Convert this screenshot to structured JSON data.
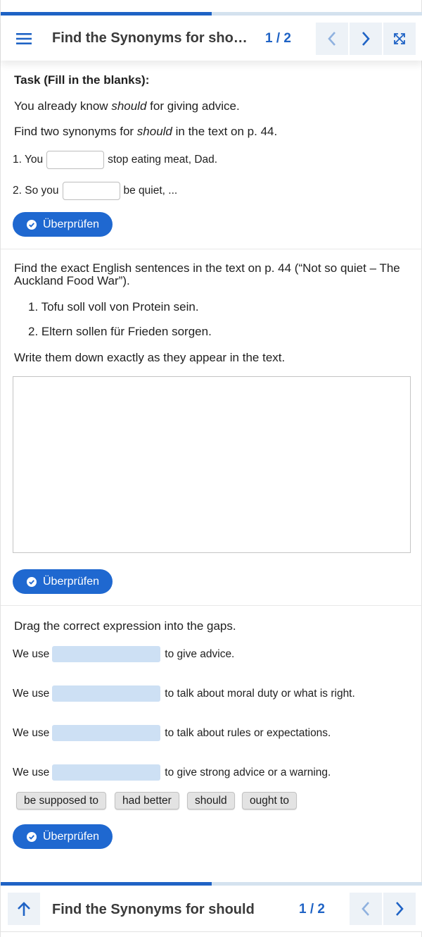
{
  "header": {
    "title": "Find the Synonyms for sho…",
    "counter": "1 / 2",
    "icons": {
      "menu": "menu-icon",
      "prev": "chevron-left-icon",
      "next": "chevron-right-icon",
      "fullscreen": "expand-icon"
    }
  },
  "progress": 0.5,
  "task1": {
    "heading": "Task (Fill in the blanks):",
    "intro_pre": "You already know ",
    "intro_em": "should",
    "intro_post": " for giving advice.",
    "find_pre": "Find two synonyms for ",
    "find_em": "should",
    "find_post": " in the text on p. 44.",
    "sentences": [
      {
        "before": "1. You",
        "after": "stop eating meat, Dad.",
        "value": ""
      },
      {
        "before": "2. So you",
        "after": "be quiet, ...",
        "value": ""
      }
    ],
    "check_label": "Überprüfen"
  },
  "task2": {
    "instruction": "Find the exact English sentences in the text on p. 44 (“Not so quiet – The Auckland Food War”).",
    "items": [
      "1. Tofu soll voll von Protein sein.",
      "2. Eltern sollen für Frieden sorgen."
    ],
    "write_instruction": "Write them down exactly as they appear in the text.",
    "answer_value": "",
    "check_label": "Überprüfen"
  },
  "task3": {
    "instruction": "Drag the correct expression into the gaps.",
    "lines": [
      {
        "before": "We use",
        "after": "to give advice."
      },
      {
        "before": "We use",
        "after": "to talk about moral duty or what is right."
      },
      {
        "before": "We use",
        "after": "to talk about rules or expectations."
      },
      {
        "before": "We use",
        "after": "to give strong advice or a warning."
      }
    ],
    "chips": [
      "be supposed to",
      "had better",
      "should",
      "ought to"
    ],
    "check_label": "Überprüfen"
  },
  "footer": {
    "title": "Find the Synonyms for should",
    "counter": "1 / 2",
    "icons": {
      "top": "arrow-up-icon",
      "prev": "chevron-left-icon",
      "next": "chevron-right-icon"
    }
  },
  "colors": {
    "accent": "#1f63c5",
    "button": "#1f68d0",
    "dropzone": "#cde0f4",
    "chip": "#e3e3e3"
  }
}
